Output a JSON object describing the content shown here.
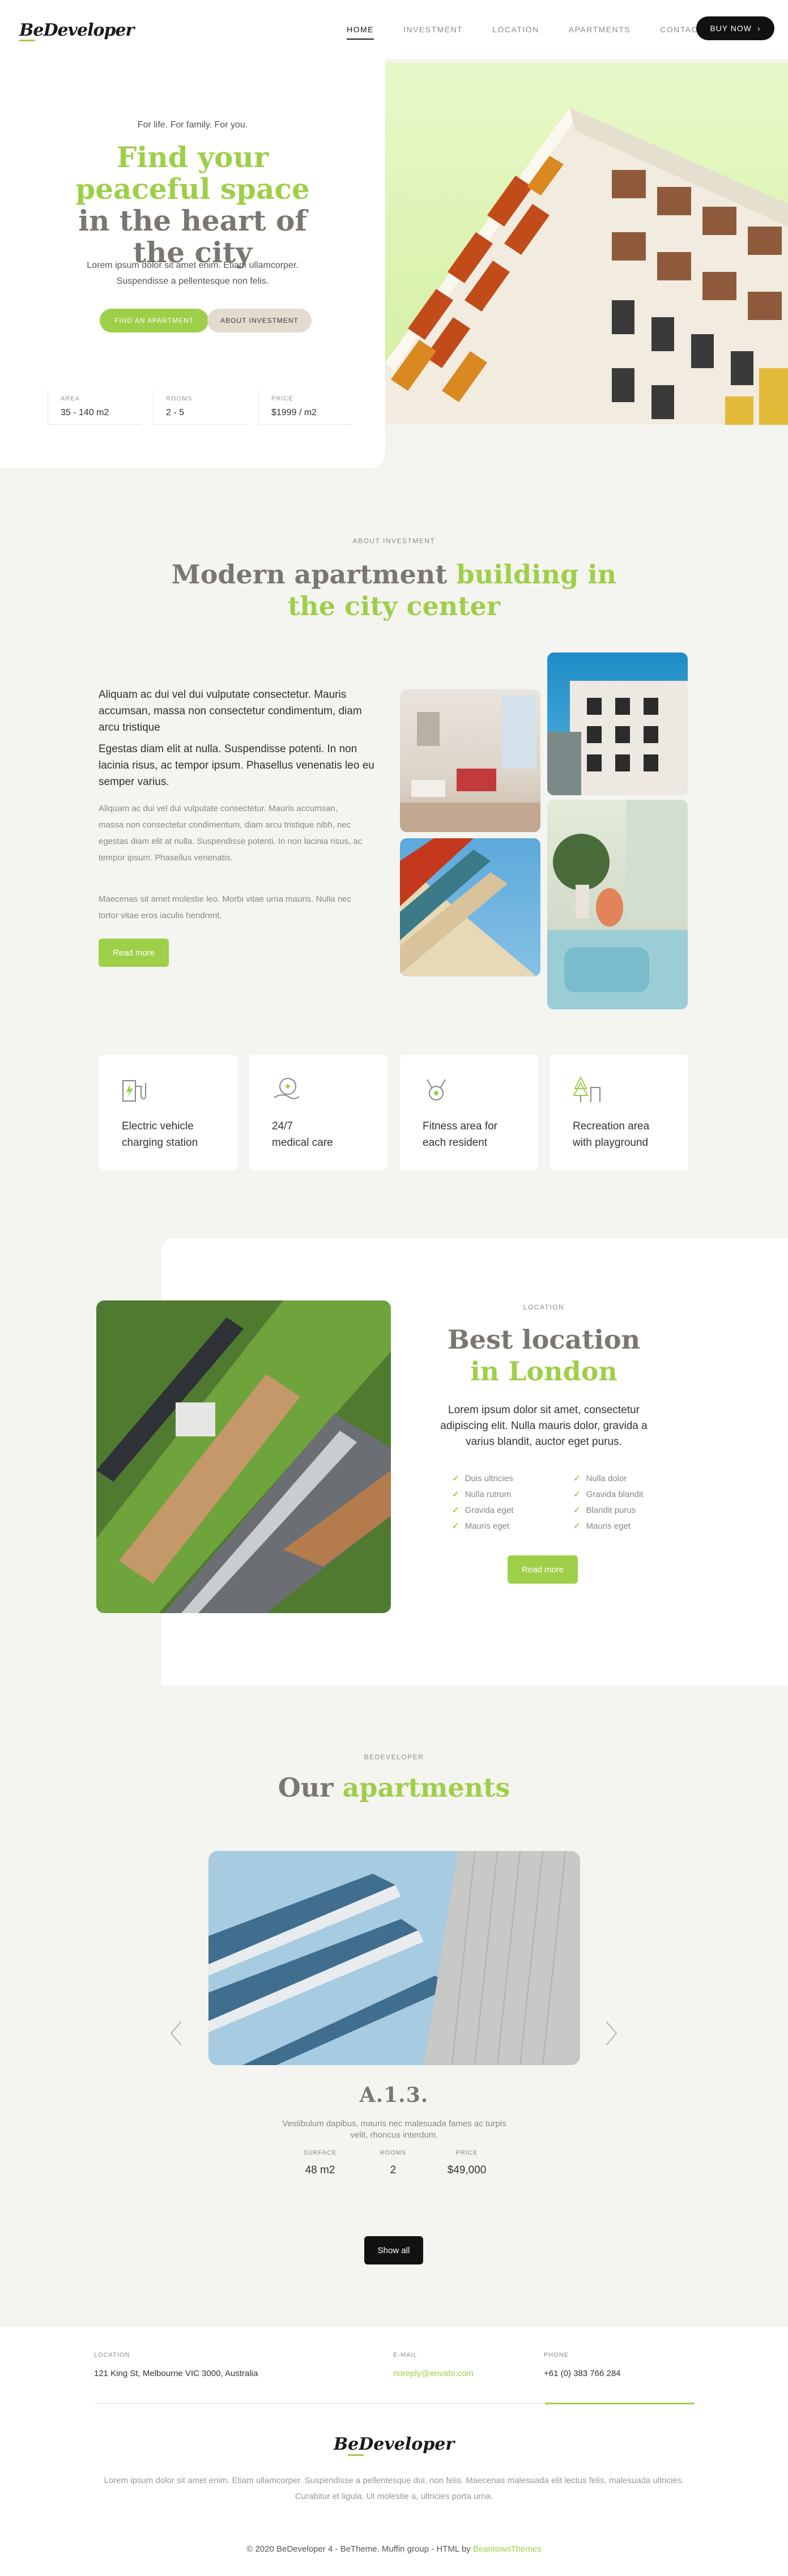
{
  "header": {
    "logo": "BeDeveloper",
    "nav": [
      "HOME",
      "INVESTMENT",
      "LOCATION",
      "APARTMENTS",
      "CONTACT"
    ],
    "active": "HOME",
    "buy_label": "BUY NOW"
  },
  "hero": {
    "kicker": "For life. For family. For you.",
    "title_green": "Find your peaceful space",
    "title_gray": " in the heart of the city",
    "text": "Lorem ipsum dolor sit amet enim. Etiam ullamcorper. Suspendisse a pellentesque non felis.",
    "btn_primary": "FIND AN APARTMENT",
    "btn_secondary": "ABOUT INVESTMENT",
    "stats": [
      {
        "label": "AREA",
        "value": "35 - 140 m2"
      },
      {
        "label": "ROOMS",
        "value": "2 - 5"
      },
      {
        "label": "PRICE",
        "value": "$1999 / m2"
      }
    ]
  },
  "about": {
    "kicker": "ABOUT INVESTMENT",
    "title_gray": "Modern apartment ",
    "title_green": "building in the city center",
    "p1": "Aliquam ac dui vel dui vulputate consectetur. Mauris accumsan, massa non consectetur condimentum, diam arcu tristique",
    "p2": "Egestas diam elit at nulla. Suspendisse potenti. In non lacinia risus, ac tempor ipsum. Phasellus venenatis leo eu semper varius.",
    "p3": "Aliquam ac dui vel dui vulputate consectetur. Mauris accumsan, massa non consectetur condimentum, diam arcu tristique nibh, nec egestas diam elit at nulla. Suspendisse potenti. In non lacinia risus, ac tempor ipsum. Phasellus venenatis.",
    "p4": "Maecenas sit amet molestie leo. Morbi vitae urna mauris. Nulla nec tortor vitae eros iaculis hendrerit.",
    "read_more": "Read more"
  },
  "features": [
    {
      "icon": "ev-charging-icon",
      "line1": "Electric vehicle",
      "line2": "charging station"
    },
    {
      "icon": "medical-care-icon",
      "line1": "24/7",
      "line2": "medical care"
    },
    {
      "icon": "fitness-icon",
      "line1": "Fitness area for",
      "line2": "each resident"
    },
    {
      "icon": "playground-icon",
      "line1": "Recreation area",
      "line2": "with playground"
    }
  ],
  "location": {
    "kicker": "LOCATION",
    "title_gray": "Best location ",
    "title_green": "in London",
    "text": "Lorem ipsum dolor sit amet, consectetur adipiscing elit. Nulla mauris dolor, gravida a varius blandit, auctor eget purus.",
    "list_left": [
      "Duis ultricies",
      "Nulla rutrum",
      "Gravida eget",
      "Mauris eget"
    ],
    "list_right": [
      "Nulla dolor",
      "Gravida blandit",
      "Blandit purus",
      "Mauris eget"
    ],
    "read_more": "Read more"
  },
  "apartments": {
    "kicker": "BEDEVELOPER",
    "title_gray": "Our ",
    "title_green": "apartments",
    "name": "A.1.3.",
    "desc": "Vestibulum dapibus, mauris nec malesuada fames ac turpis velit, rhoncus interdum.",
    "stats": [
      {
        "label": "SURFACE",
        "value": "48 m2"
      },
      {
        "label": "ROOMS",
        "value": "2"
      },
      {
        "label": "PRICE",
        "value": "$49,000"
      }
    ],
    "show_all": "Show all"
  },
  "footer": {
    "location_label": "LOCATION",
    "location_value": "121 King St, Melbourne VIC 3000, Australia",
    "email_label": "E-MAIL",
    "email_value": "noreply@envato.com",
    "phone_label": "PHONE",
    "phone_value": "+61 (0) 383 766 284",
    "logo": "BeDeveloper",
    "text": "Lorem ipsum dolor sit amet enim. Etiam ullamcorper. Suspendisse a pellentesque dui, non felis. Maecenas malesuada elit lectus felis, malesuada ultricies. Curabitur et ligula. Ut molestie a, ultricies porta urna.",
    "copyright": "© 2020 BeDeveloper 4 - BeTheme. Muffin group - HTML by ",
    "copyright_link": "BeantownThemes"
  },
  "colors": {
    "accent": "#9ecf48",
    "title_gray": "#7a7670",
    "dark": "#111111",
    "background": "#f4f4f1"
  }
}
